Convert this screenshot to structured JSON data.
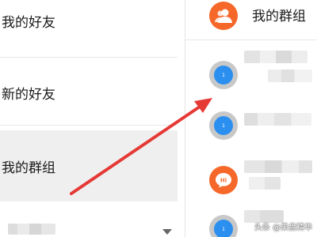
{
  "menu": {
    "items": [
      {
        "label": "我的好友"
      },
      {
        "label": "新的好友"
      },
      {
        "label": "我的群组"
      }
    ]
  },
  "groups_panel": {
    "title": "我的群组",
    "avatar_badges": [
      "1",
      "1",
      "Hi",
      "1"
    ]
  },
  "watermark": "头条 @果盘精华",
  "colors": {
    "accent_orange": "#f5682a",
    "avatar_blue": "#2b8ff0",
    "arrow_red": "#e53935",
    "selected_bg": "#efefef"
  }
}
